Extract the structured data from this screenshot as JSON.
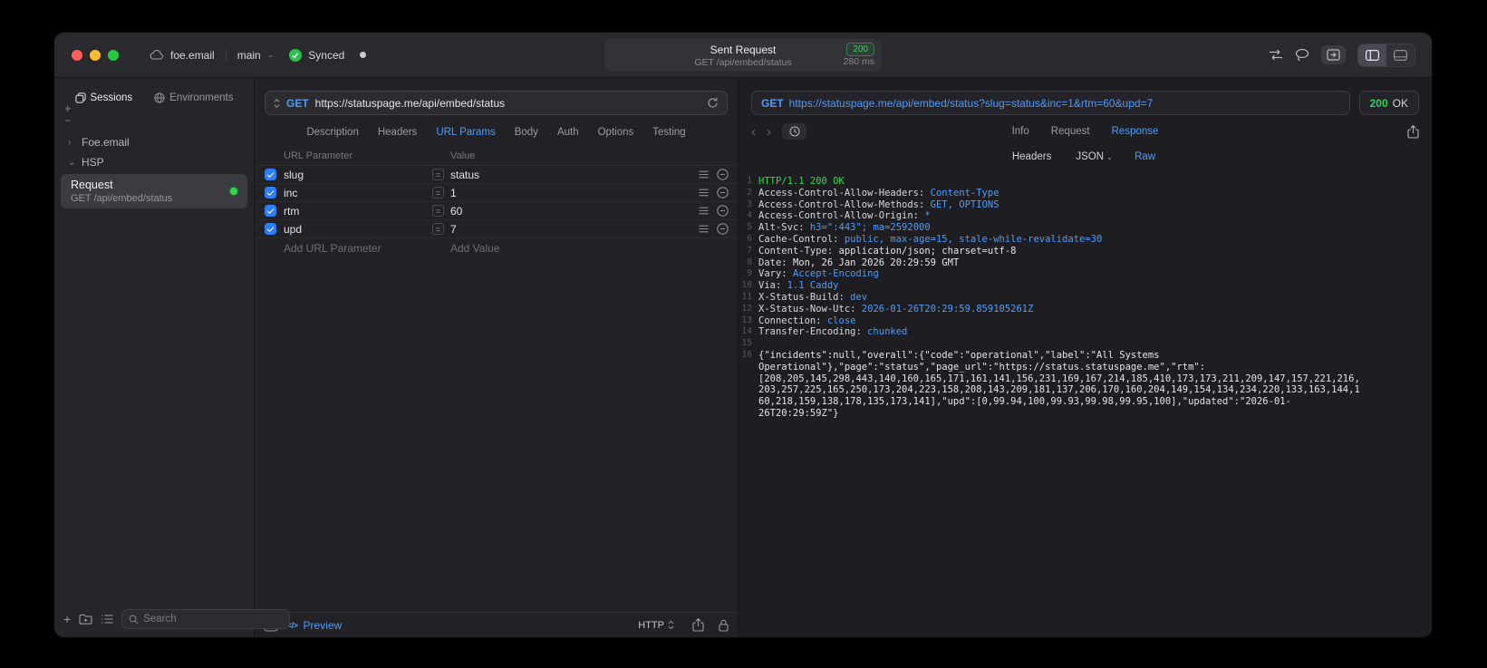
{
  "colors": {
    "accent_blue": "#4f9cf7",
    "success_green": "#30d158",
    "checkbox_blue": "#2f7cf6",
    "traffic_red": "#ff5f57",
    "traffic_yellow": "#febc2e",
    "traffic_green": "#28c840"
  },
  "titlebar": {
    "project": "foe.email",
    "branch": "main",
    "sync_label": "Synced",
    "summary": {
      "title": "Sent Request",
      "status_code": "200",
      "request_line": "GET /api/embed/status",
      "duration": "280 ms"
    }
  },
  "sidebar": {
    "tab_sessions": "Sessions",
    "tab_environments": "Environments",
    "add_label": "+",
    "remove_label": "−",
    "tree": [
      {
        "chevron": "›",
        "label": "Foe.email"
      },
      {
        "chevron": "⌄",
        "label": "HSP"
      }
    ],
    "request_item": {
      "title": "Request",
      "subtitle": "GET /api/embed/status"
    },
    "search_placeholder": "Search"
  },
  "request": {
    "method": "GET",
    "url": "https://statuspage.me/api/embed/status",
    "tabs": [
      {
        "label": "Description",
        "active": false
      },
      {
        "label": "Headers",
        "active": false
      },
      {
        "label": "URL Params",
        "active": true
      },
      {
        "label": "Body",
        "active": false
      },
      {
        "label": "Auth",
        "active": false
      },
      {
        "label": "Options",
        "active": false
      },
      {
        "label": "Testing",
        "active": false
      }
    ],
    "param_header": "URL Parameter",
    "value_header": "Value",
    "params": [
      {
        "name": "slug",
        "value": "status",
        "checked": true
      },
      {
        "name": "inc",
        "value": "1",
        "checked": true
      },
      {
        "name": "rtm",
        "value": "60",
        "checked": true
      },
      {
        "name": "upd",
        "value": "7",
        "checked": true
      }
    ],
    "add_param": "Add URL Parameter",
    "add_value": "Add Value",
    "code_glyph": "</>",
    "preview_label": "Preview",
    "protocol": "HTTP"
  },
  "response": {
    "method": "GET",
    "url": "https://statuspage.me/api/embed/status?slug=status&inc=1&rtm=60&upd=7",
    "status_code": "200",
    "status_text": "OK",
    "tabs": [
      {
        "label": "Info",
        "active": false
      },
      {
        "label": "Request",
        "active": false
      },
      {
        "label": "Response",
        "active": true
      }
    ],
    "modes": [
      {
        "label": "Headers",
        "chevron": "",
        "active": false
      },
      {
        "label": "JSON",
        "chevron": "⌄",
        "active": false
      },
      {
        "label": "Raw",
        "chevron": "",
        "active": true
      }
    ],
    "lines": [
      {
        "n": "1",
        "name": "",
        "value": "HTTP/1.1 200 OK",
        "cls": "tok-green"
      },
      {
        "n": "2",
        "name": "Access-Control-Allow-Headers: ",
        "value": "Content-Type",
        "cls": "tok-blue"
      },
      {
        "n": "3",
        "name": "Access-Control-Allow-Methods: ",
        "value": "GET, OPTIONS",
        "cls": "tok-blue"
      },
      {
        "n": "4",
        "name": "Access-Control-Allow-Origin: ",
        "value": "*",
        "cls": "tok-blue"
      },
      {
        "n": "5",
        "name": "Alt-Svc: ",
        "value": "h3=\":443\"; ma=2592000",
        "cls": "tok-blue"
      },
      {
        "n": "6",
        "name": "Cache-Control: ",
        "value": "public, max-age=15, stale-while-revalidate=30",
        "cls": "tok-blue"
      },
      {
        "n": "7",
        "name": "Content-Type: ",
        "value": "application/json; charset=utf-8",
        "cls": "tok-white"
      },
      {
        "n": "8",
        "name": "Date: ",
        "value": "Mon, 26 Jan 2026 20:29:59 GMT",
        "cls": "tok-white"
      },
      {
        "n": "9",
        "name": "Vary: ",
        "value": "Accept-Encoding",
        "cls": "tok-blue"
      },
      {
        "n": "10",
        "name": "Via: ",
        "value": "1.1 Caddy",
        "cls": "tok-blue"
      },
      {
        "n": "11",
        "name": "X-Status-Build: ",
        "value": "dev",
        "cls": "tok-blue"
      },
      {
        "n": "12",
        "name": "X-Status-Now-Utc: ",
        "value": "2026-01-26T20:29:59.859105261Z",
        "cls": "tok-blue"
      },
      {
        "n": "13",
        "name": "Connection: ",
        "value": "close",
        "cls": "tok-blue"
      },
      {
        "n": "14",
        "name": "Transfer-Encoding: ",
        "value": "chunked",
        "cls": "tok-blue"
      },
      {
        "n": "15",
        "name": "",
        "value": "",
        "cls": ""
      },
      {
        "n": "16",
        "name": "",
        "value": "{\"incidents\":null,\"overall\":{\"code\":\"operational\",\"label\":\"All Systems Operational\"},\"page\":\"status\",\"page_url\":\"https://status.statuspage.me\",\"rtm\":[208,205,145,298,443,140,160,165,171,161,141,156,231,169,167,214,185,410,173,173,211,209,147,157,221,216,203,257,225,165,250,173,204,223,158,208,143,209,181,137,206,170,160,204,149,154,134,234,220,133,163,144,160,218,159,138,178,135,173,141],\"upd\":[0,99.94,100,99.93,99.98,99.95,100],\"updated\":\"2026-01-26T20:29:59Z\"}",
        "cls": "tok-white"
      }
    ]
  }
}
